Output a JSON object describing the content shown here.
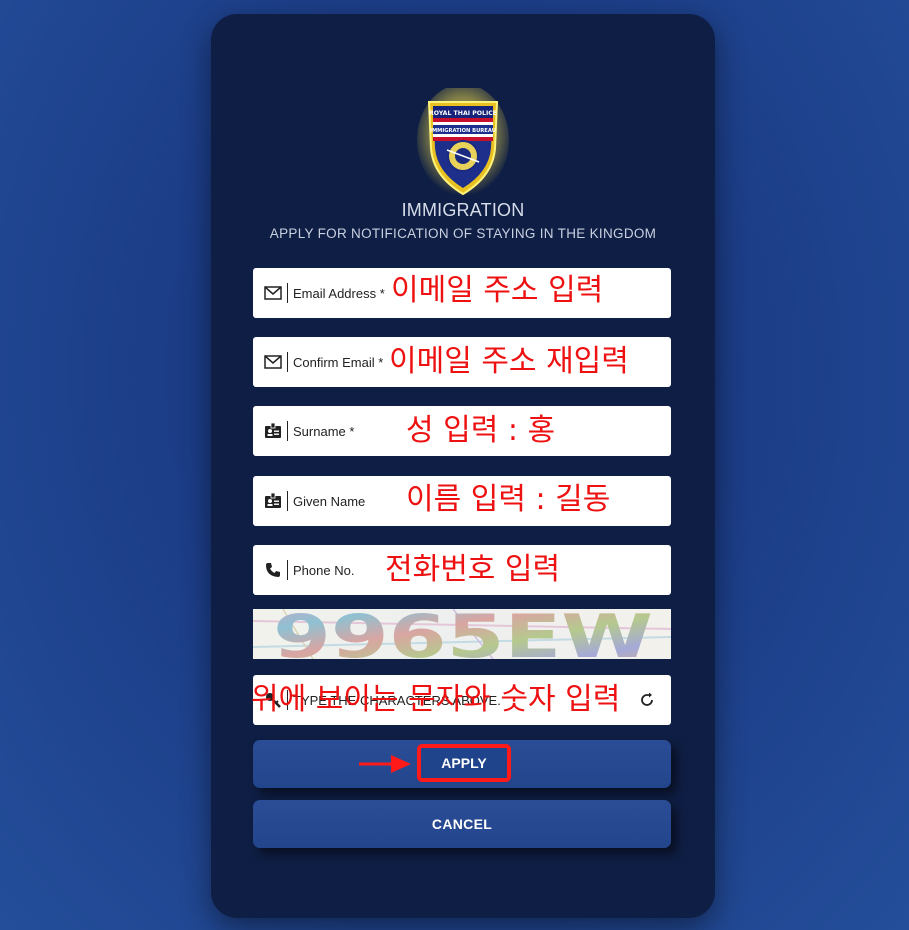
{
  "header": {
    "title": "IMMIGRATION",
    "subtitle": "APPLY FOR NOTIFICATION OF STAYING IN THE KINGDOM",
    "logo_text_top": "ROYAL THAI POLICE",
    "logo_text_mid": "IMMIGRATION BUREAU"
  },
  "form": {
    "email": {
      "placeholder": "Email Address *",
      "note": "이메일 주소 입력",
      "icon": "mail-icon"
    },
    "confirm_email": {
      "placeholder": "Confirm Email *",
      "note": "이메일 주소 재입력",
      "icon": "mail-icon"
    },
    "surname": {
      "placeholder": "Surname *",
      "note": "성 입력 : 홍",
      "icon": "id-card-icon"
    },
    "given_name": {
      "placeholder": "Given Name",
      "note": "이름 입력 : 길동",
      "icon": "id-card-icon"
    },
    "phone": {
      "placeholder": "Phone No.",
      "note": "전화번호 입력",
      "icon": "phone-icon"
    },
    "captcha_text": "9965EW",
    "captcha_input": {
      "placeholder": "TYPE THE CHARACTERS ABOVE.",
      "note": "위에 보이는 문자와 숫자 입력",
      "icon": "key-icon"
    }
  },
  "buttons": {
    "apply": "APPLY",
    "cancel": "CANCEL"
  },
  "colors": {
    "annotation": "#ee1111",
    "card": "#0f1e44",
    "button": "#2a4d96"
  }
}
